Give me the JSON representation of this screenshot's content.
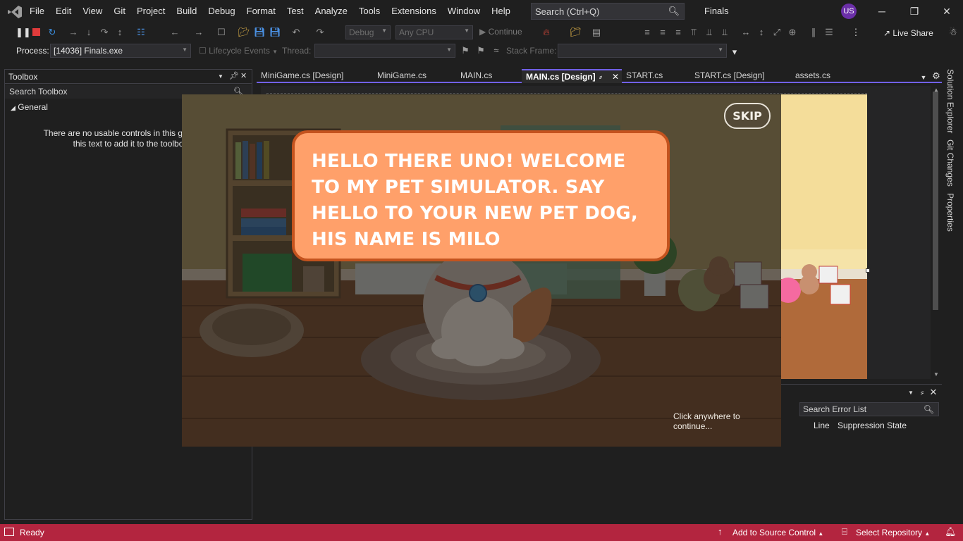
{
  "menubar": {
    "items": [
      "File",
      "Edit",
      "View",
      "Git",
      "Project",
      "Build",
      "Debug",
      "Format",
      "Test",
      "Analyze",
      "Tools",
      "Extensions",
      "Window",
      "Help"
    ],
    "search_placeholder": "Search (Ctrl+Q)",
    "solution_name": "Finals",
    "avatar_initials": "US"
  },
  "toolbar": {
    "config": "Debug",
    "platform": "Any CPU",
    "continue_label": "Continue",
    "live_share_label": "Live Share"
  },
  "debugbar": {
    "process_label": "Process:",
    "process_value": "[14036] Finals.exe",
    "lifecycle_label": "Lifecycle Events",
    "thread_label": "Thread:",
    "stack_frame_label": "Stack Frame:"
  },
  "toolbox": {
    "title": "Toolbox",
    "search_placeholder": "Search Toolbox",
    "group": "General",
    "empty_line1": "There are no usable controls in this group. Dr",
    "empty_line2": "this text to add it to the toolbo"
  },
  "tabs": [
    {
      "label": "MiniGame.cs [Design]"
    },
    {
      "label": "MiniGame.cs"
    },
    {
      "label": "MAIN.cs"
    },
    {
      "label": "MAIN.cs [Design]"
    },
    {
      "label": "START.cs"
    },
    {
      "label": "START.cs [Design]"
    },
    {
      "label": "assets.cs"
    }
  ],
  "side_tabs": [
    "Solution Explorer",
    "Git Changes",
    "Properties"
  ],
  "error_list": {
    "search_placeholder": "Search Error List",
    "columns": [
      "Line",
      "Suppression State"
    ]
  },
  "game": {
    "skip_label": "SKIP",
    "dialog_text": "HELLO THERE UNO! WELCOME TO MY PET SIMULATOR. SAY HELLO TO YOUR NEW PET DOG, HIS NAME IS MILO",
    "continue_hint": "Click anywhere to continue..."
  },
  "statusbar": {
    "ready": "Ready",
    "add_source_control": "Add to Source Control",
    "select_repository": "Select Repository"
  },
  "colors": {
    "statusbar": "#b3253f",
    "accent": "#7160e8",
    "bubble_fill": "#ffa06a",
    "bubble_border": "#c4531e"
  }
}
